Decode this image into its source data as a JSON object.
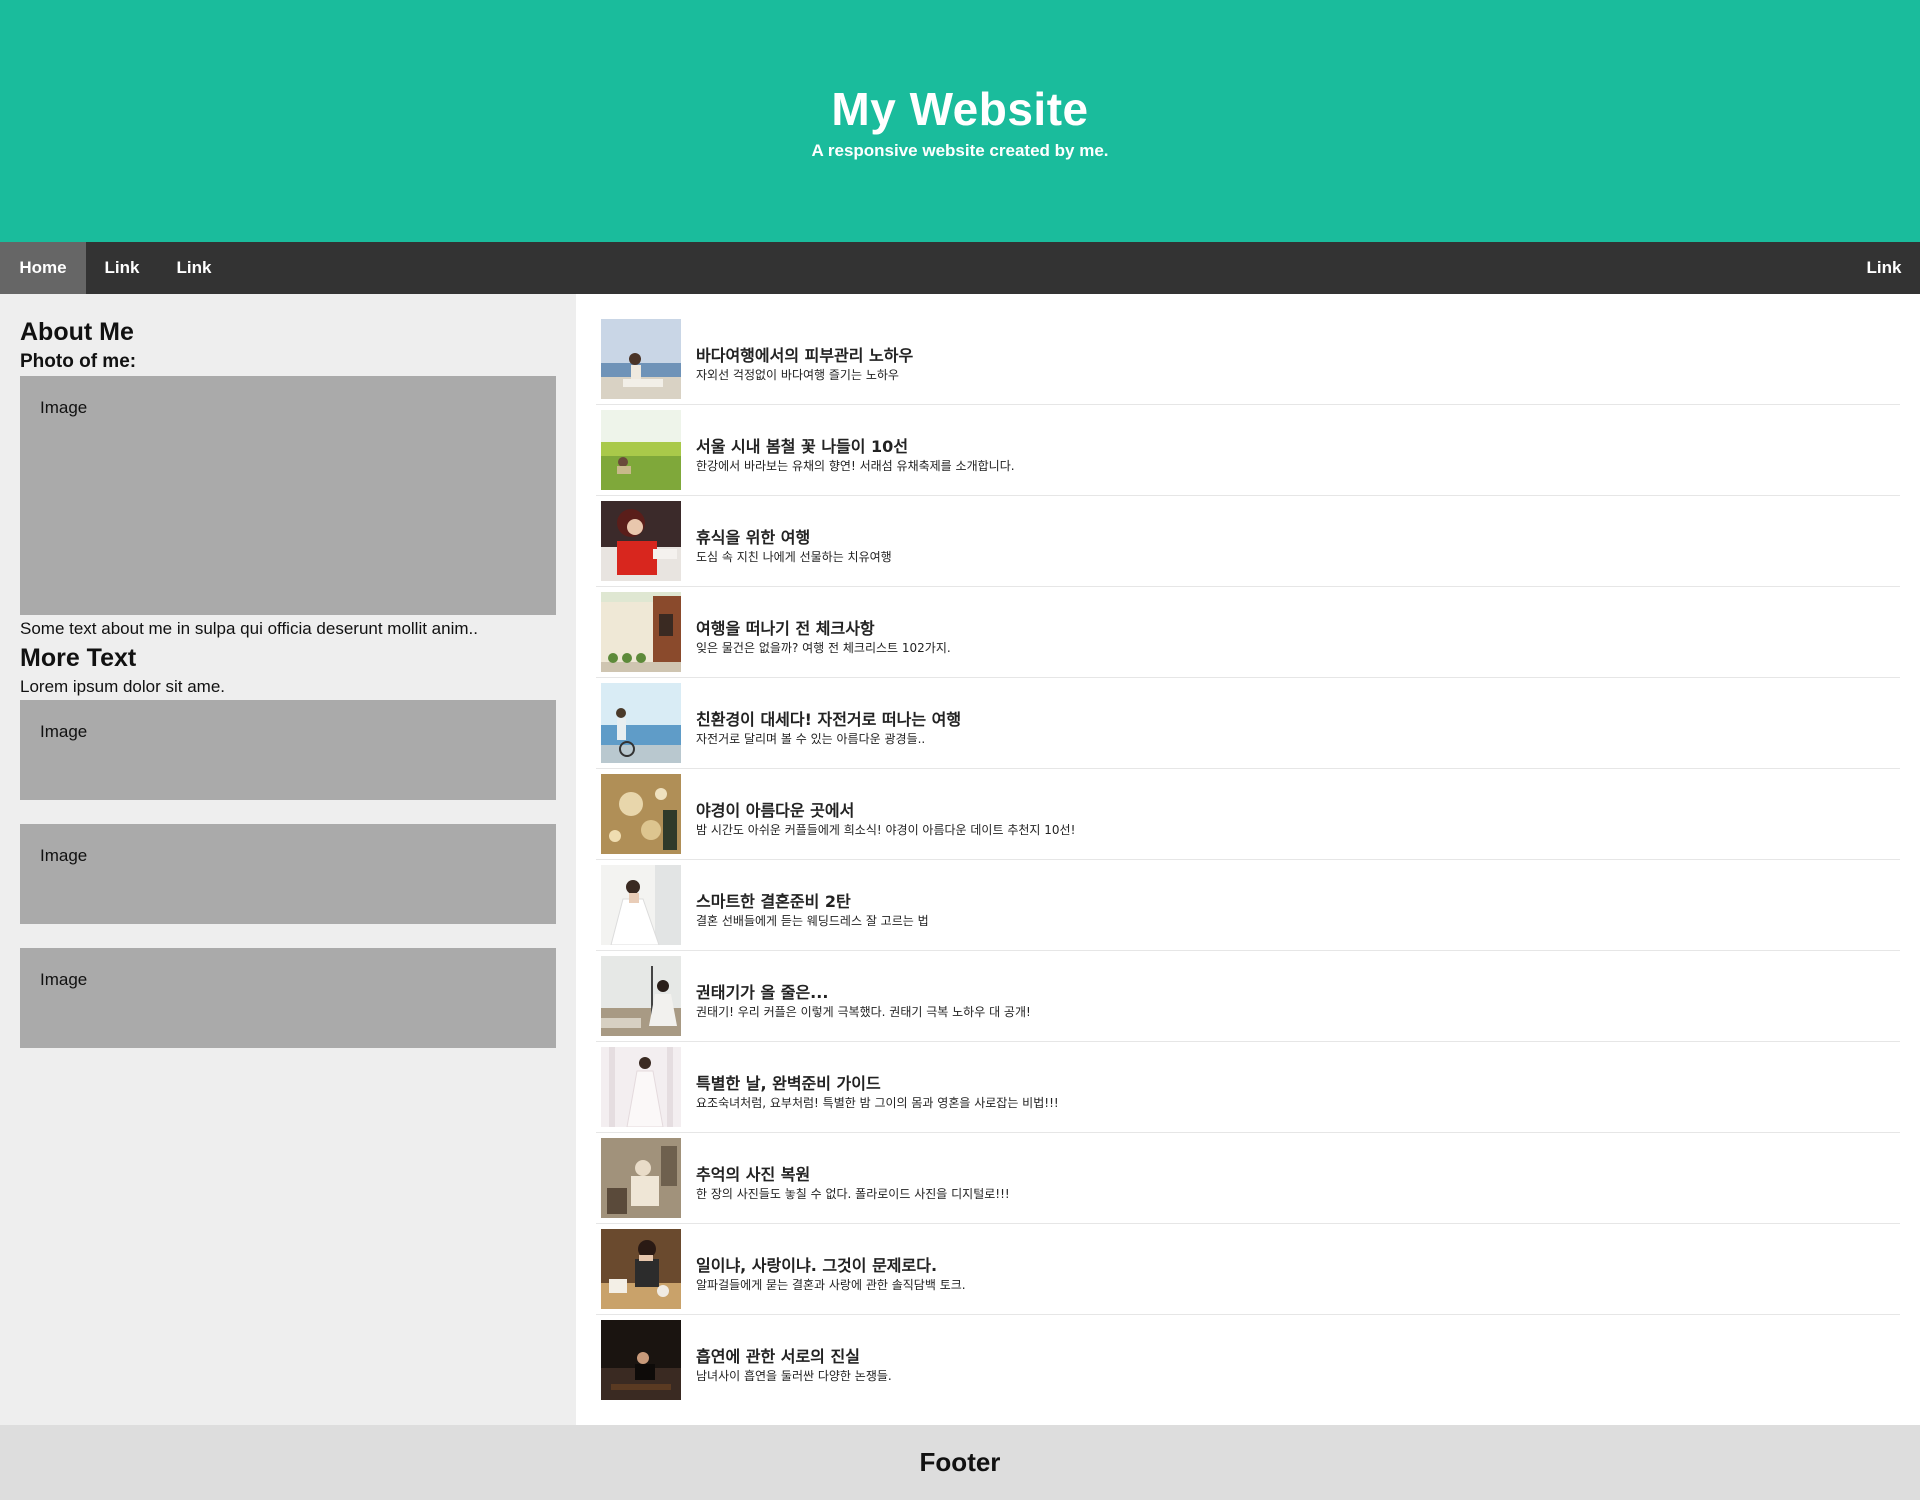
{
  "header": {
    "title": "My Website",
    "subtitle": "A responsive website created by me."
  },
  "nav": {
    "home": "Home",
    "link1": "Link",
    "link2": "Link",
    "link_right": "Link"
  },
  "side": {
    "about_heading": "About Me",
    "photo_label": "Photo of me:",
    "image_label": "Image",
    "about_text": "Some text about me in sulpa qui officia deserunt mollit anim..",
    "more_heading": "More Text",
    "more_text": "Lorem ipsum dolor sit ame.",
    "image_label_2": "Image",
    "image_label_3": "Image",
    "image_label_4": "Image"
  },
  "articles": [
    {
      "title": "바다여행에서의 피부관리 노하우",
      "desc": "자외선 걱정없이 바다여행 즐기는 노하우",
      "thumb": "beach-photo"
    },
    {
      "title": "서울 시내 봄철 꽃 나들이 10선",
      "desc": "한강에서 바라보는 유채의 향연! 서래섬 유채축제를 소개합니다.",
      "thumb": "flower-field-photo"
    },
    {
      "title": "휴식을 위한 여행",
      "desc": "도심 속 지친 나에게 선물하는 치유여행",
      "thumb": "woman-red-photo"
    },
    {
      "title": "여행을 떠나기 전 체크사항",
      "desc": "잊은 물건은 없을까? 여행 전 체크리스트 102가지.",
      "thumb": "house-photo"
    },
    {
      "title": "친환경이 대세다! 자전거로 떠나는 여행",
      "desc": "자전거로 달리며 볼 수 있는 아름다운 광경들..",
      "thumb": "bicycle-sea-photo"
    },
    {
      "title": "야경이 아름다운 곳에서",
      "desc": "밤 시간도 아쉬운 커플들에게 희소식! 야경이 아름다운 데이트 추천지 10선!",
      "thumb": "night-lights-photo"
    },
    {
      "title": "스마트한 결혼준비 2탄",
      "desc": "결혼 선배들에게 듣는 웨딩드레스 잘 고르는 법",
      "thumb": "wedding-dress-photo"
    },
    {
      "title": "권태기가 올 줄은...",
      "desc": "권태기! 우리 커플은 이렇게 극복했다. 권태기 극복 노하우 대 공개!",
      "thumb": "couple-outdoor-photo"
    },
    {
      "title": "특별한 날, 완벽준비 가이드",
      "desc": "요조숙녀처럼, 요부처럼! 특별한 밤 그이의 몸과 영혼을 사로잡는 비법!!!",
      "thumb": "white-dress-photo"
    },
    {
      "title": "추억의 사진 복원",
      "desc": "한 장의 사진들도 놓칠 수 없다. 폴라로이드 사진을 디지털로!!!",
      "thumb": "vintage-photo"
    },
    {
      "title": "일이냐, 사랑이냐. 그것이 문제로다.",
      "desc": "알파걸들에게 묻는 결혼과 사랑에 관한 솔직담백 토크.",
      "thumb": "cafe-woman-photo"
    },
    {
      "title": "흡연에 관한 서로의 진실",
      "desc": "남녀사이 흡연을 둘러싼 다양한 논쟁들.",
      "thumb": "dark-room-photo"
    }
  ],
  "footer": {
    "text": "Footer"
  }
}
